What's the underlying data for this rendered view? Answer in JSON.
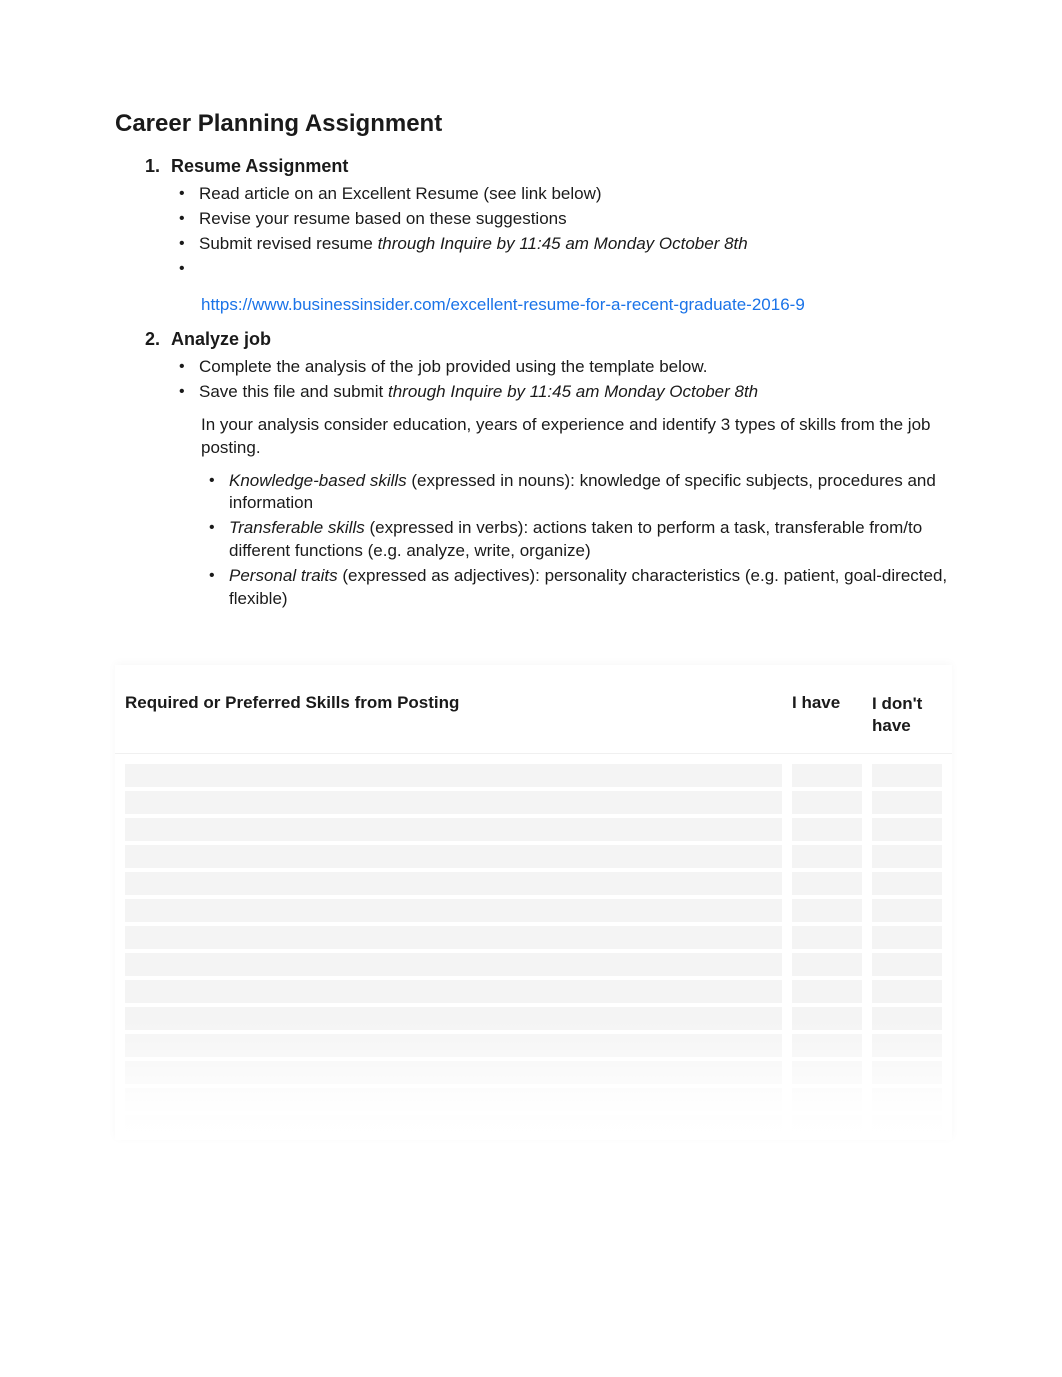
{
  "title": "Career Planning Assignment",
  "section1": {
    "number": "1.",
    "heading": "Resume Assignment",
    "bullets": [
      "Read article on an Excellent Resume (see link below)",
      "Revise your resume based on these suggestions"
    ],
    "bullet_submit_prefix": "Submit revised resume ",
    "bullet_submit_italic": "through Inquire by 11:45 am Monday October 8th",
    "link": "https://www.businessinsider.com/excellent-resume-for-a-recent-graduate-2016-9"
  },
  "section2": {
    "number": "2.",
    "heading": "Analyze job",
    "bullets": [
      "Complete the analysis of the job provided using the template below."
    ],
    "bullet_save_prefix": "Save this file and submit ",
    "bullet_save_italic": "through Inquire by 11:45 am Monday October 8th",
    "para": "In your analysis consider education, years of experience and identify 3 types of skills from the job posting.",
    "skills": [
      {
        "name": "Knowledge-based skills",
        "desc": " (expressed in nouns): knowledge of specific subjects, procedures and information"
      },
      {
        "name": "Transferable skills",
        "desc": " (expressed in verbs): actions taken to perform a task, transferable from/to different functions (e.g. analyze, write, organize)"
      },
      {
        "name": "Personal traits",
        "desc": " (expressed as adjectives): personality characteristics (e.g. patient, goal-directed, flexible)"
      }
    ]
  },
  "table": {
    "col_skills": "Required or Preferred Skills from Posting",
    "col_have": "I have",
    "col_donthave": "I don't have",
    "row_count": 14,
    "rows": [
      {
        "skill": "",
        "have": "",
        "dont": ""
      },
      {
        "skill": "",
        "have": "",
        "dont": ""
      },
      {
        "skill": "",
        "have": "",
        "dont": ""
      },
      {
        "skill": "",
        "have": "",
        "dont": ""
      },
      {
        "skill": "",
        "have": "",
        "dont": ""
      },
      {
        "skill": "",
        "have": "",
        "dont": ""
      },
      {
        "skill": "",
        "have": "",
        "dont": ""
      },
      {
        "skill": "",
        "have": "",
        "dont": ""
      },
      {
        "skill": "",
        "have": "",
        "dont": ""
      },
      {
        "skill": "",
        "have": "",
        "dont": ""
      },
      {
        "skill": "",
        "have": "",
        "dont": ""
      },
      {
        "skill": "",
        "have": "",
        "dont": ""
      },
      {
        "skill": "",
        "have": "",
        "dont": ""
      },
      {
        "skill": "",
        "have": "",
        "dont": ""
      }
    ]
  }
}
